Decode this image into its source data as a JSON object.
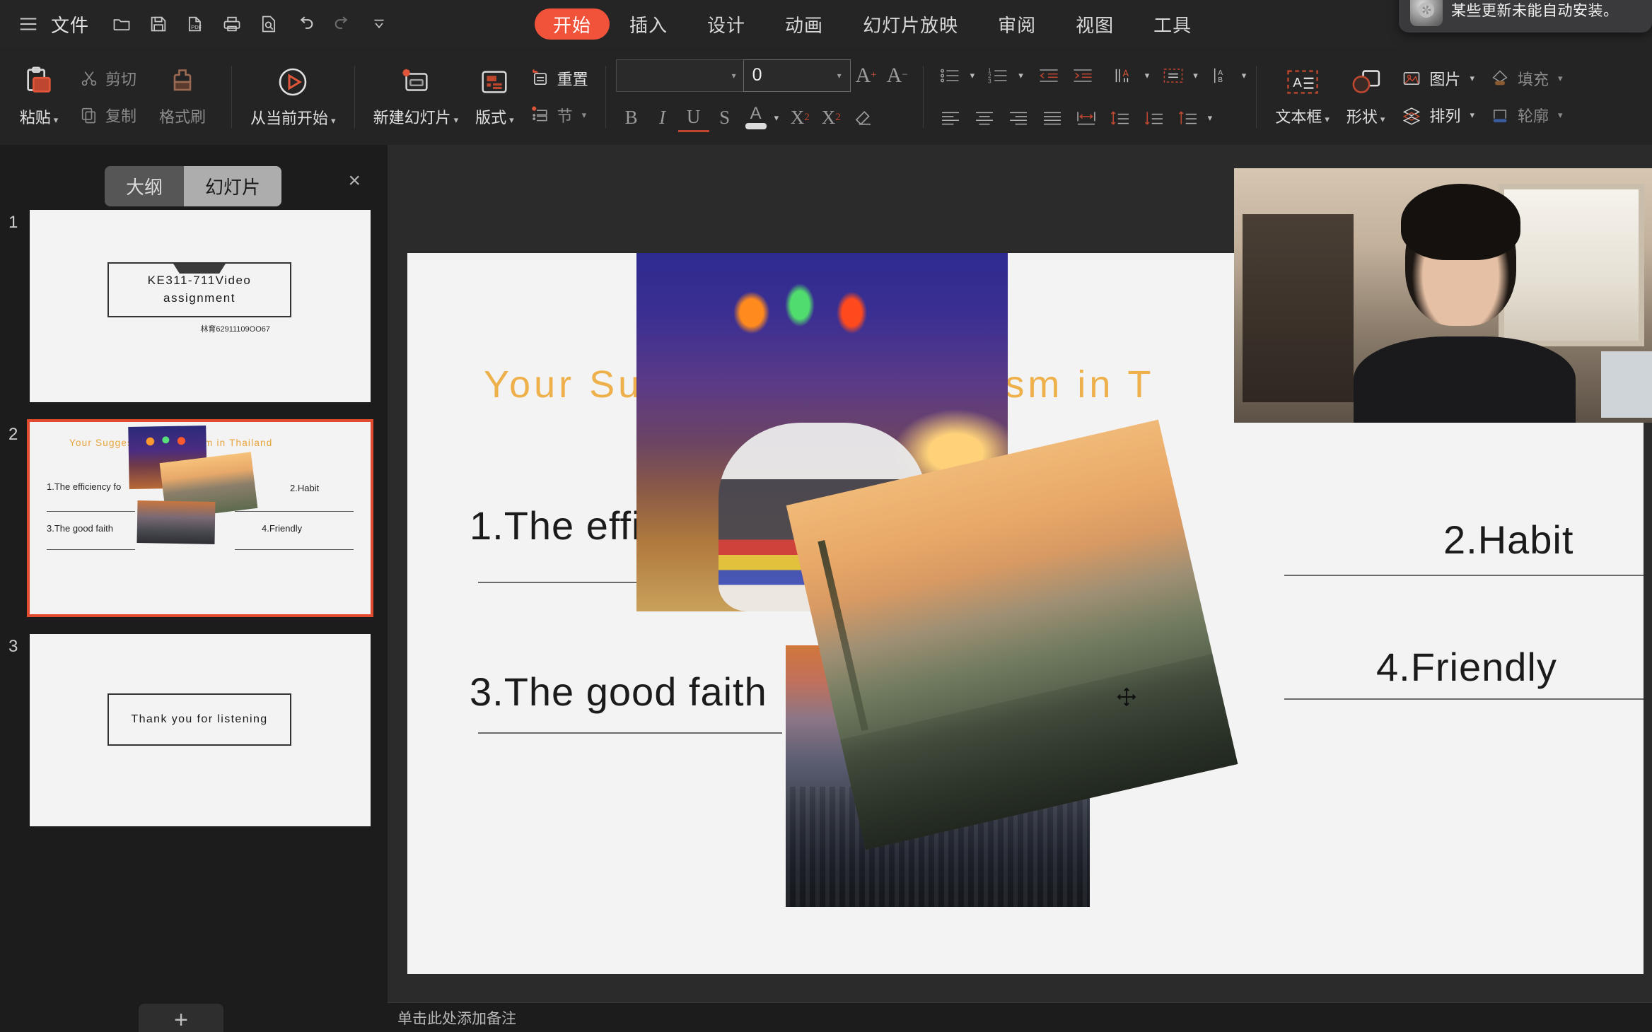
{
  "menubar": {
    "hamburger_icon": "hamburger-menu-icon",
    "file_label": "文件",
    "quick_icons": [
      {
        "name": "open-folder-icon",
        "label": "打开"
      },
      {
        "name": "save-icon",
        "label": "保存"
      },
      {
        "name": "export-pdf-icon",
        "label": "PDF"
      },
      {
        "name": "print-icon",
        "label": "打印"
      },
      {
        "name": "print-preview-icon",
        "label": "打印预览"
      },
      {
        "name": "undo-icon",
        "label": "撤消"
      },
      {
        "name": "redo-icon",
        "label": "恢复"
      },
      {
        "name": "customize-chevron-icon",
        "label": "自定义"
      }
    ],
    "tabs": [
      {
        "label": "开始",
        "active": true
      },
      {
        "label": "插入",
        "active": false
      },
      {
        "label": "设计",
        "active": false
      },
      {
        "label": "动画",
        "active": false
      },
      {
        "label": "幻灯片放映",
        "active": false
      },
      {
        "label": "审阅",
        "active": false
      },
      {
        "label": "视图",
        "active": false
      },
      {
        "label": "工具",
        "active": false
      }
    ],
    "active_tab_color": "#f0533a"
  },
  "notification": {
    "icon": "system-update-gear-icon",
    "text": "某些更新未能自动安装。"
  },
  "ribbon": {
    "paste": "粘贴",
    "cut": "剪切",
    "copy": "复制",
    "format_painter": "格式刷",
    "play_from_current": "从当前开始",
    "new_slide": "新建幻灯片",
    "layout": "版式",
    "reset": "重置",
    "section": "节",
    "font_name": "",
    "font_name_placeholder": "",
    "font_size": "0",
    "bold": "B",
    "italic": "I",
    "underline": "U",
    "strikethrough": "S",
    "text_color": "A",
    "superscript": "X²",
    "subscript": "X₂",
    "clear_format_icon": "eraser-icon",
    "increase_font_icon": "increase-font-size-icon",
    "decrease_font_icon": "decrease-font-size-icon",
    "bullet_list_icon": "bullet-list-icon",
    "number_list_icon": "numbered-list-icon",
    "decrease_indent_icon": "decrease-indent-icon",
    "increase_indent_icon": "increase-indent-icon",
    "text_direction_icon": "text-direction-icon",
    "align_left_icon": "align-left-icon",
    "align_center_icon": "align-center-icon",
    "align_right_icon": "align-right-icon",
    "justify_icon": "justify-icon",
    "distribute_icon": "distribute-icon",
    "line_spacing_icon": "line-spacing-icon",
    "paragraph_spacing_icon": "paragraph-spacing-icon",
    "align_text_box_icon": "align-text-in-box-icon",
    "vertical_text_icon": "vertical-text-icon",
    "textbox": "文本框",
    "shape": "形状",
    "picture": "图片",
    "arrange": "排列",
    "fill": "填充",
    "outline": "轮廓"
  },
  "left_panel": {
    "view_toggle": [
      {
        "label": "大纲",
        "active": false
      },
      {
        "label": "幻灯片",
        "active": true
      }
    ],
    "close_icon": "close-panel-icon",
    "add_slide_label": "+",
    "slides": [
      {
        "number": "1",
        "selected": false,
        "title_line1": "KE311-711Video",
        "title_line2": "assignment",
        "author": "林育62911109OO67"
      },
      {
        "number": "2",
        "selected": true,
        "title": "Your  Suggestions to Tourism in  Thailand",
        "items": [
          "1.The efficiency fo",
          "2.Habit",
          "3.The good faith",
          "4.Friendly"
        ]
      },
      {
        "number": "3",
        "selected": false,
        "text": "Thank  you  for  listening"
      }
    ]
  },
  "canvas": {
    "title": "Your  Suggestions  to  Tourism  in  T",
    "title_color": "#edb04b",
    "bullets": [
      {
        "text": "1.The efficiency fo"
      },
      {
        "text": "2.Habit"
      },
      {
        "text": "3.The good faith"
      },
      {
        "text": "4.Friendly"
      }
    ],
    "photos": [
      {
        "name": "photo-tuktuk-interior"
      },
      {
        "name": "photo-street-sunset-palms"
      },
      {
        "name": "photo-city-skyline-dusk"
      }
    ],
    "cursor_icon": "move-crosshair-cursor"
  },
  "webcam": {
    "name": "webcam-video-overlay"
  },
  "notes": {
    "placeholder": "单击此处添加备注"
  }
}
